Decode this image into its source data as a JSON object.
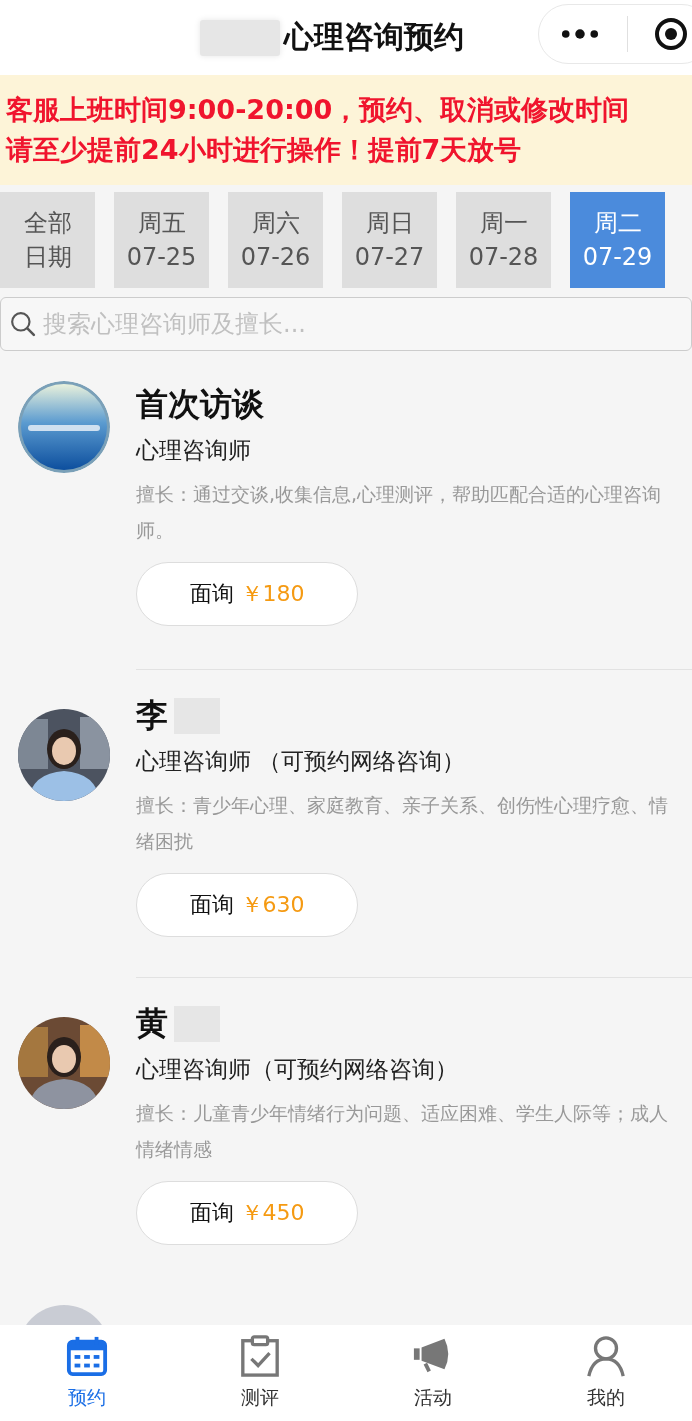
{
  "header": {
    "title": "心理咨询预约",
    "title_redacted": true
  },
  "notice": {
    "lines": [
      "客服上班时间9:00-20:00，预约、取消或修改时间",
      "请至少提前24小时进行操作！提前7天放号"
    ]
  },
  "date_tabs": [
    {
      "top": "全部",
      "bottom": "日期",
      "selected": false
    },
    {
      "top": "周五",
      "bottom": "07-25",
      "selected": false
    },
    {
      "top": "周六",
      "bottom": "07-26",
      "selected": false
    },
    {
      "top": "周日",
      "bottom": "07-27",
      "selected": false
    },
    {
      "top": "周一",
      "bottom": "07-28",
      "selected": false
    },
    {
      "top": "周二",
      "bottom": "07-29",
      "selected": true
    }
  ],
  "search": {
    "placeholder": "搜索心理咨询师及擅长..."
  },
  "counselors": [
    {
      "kind": "logo",
      "name": "首次访谈",
      "redacted": false,
      "role": "心理咨询师",
      "specialty": "擅长：通过交谈,收集信息,心理测评，帮助匹配合适的心理咨询师。",
      "button_label": "面询",
      "price": "￥180"
    },
    {
      "name": "李",
      "redacted": true,
      "role": "心理咨询师 （可预约网络咨询）",
      "specialty": "擅长：青少年心理、家庭教育、亲子关系、创伤性心理疗愈、情绪困扰",
      "button_label": "面询",
      "price": "￥630"
    },
    {
      "name": "黄",
      "redacted": true,
      "role": "心理咨询师（可预约网络咨询）",
      "specialty": "擅长：儿童青少年情绪行为问题、适应困难、学生人际等；成人情绪情感",
      "button_label": "面询",
      "price": "￥450"
    }
  ],
  "tab_bar": [
    {
      "label": "预约",
      "selected": true
    },
    {
      "label": "测评",
      "selected": false
    },
    {
      "label": "活动",
      "selected": false
    },
    {
      "label": "我的",
      "selected": false
    }
  ]
}
